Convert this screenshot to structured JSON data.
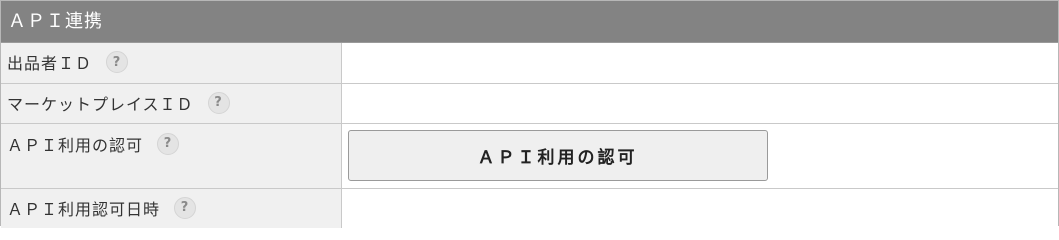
{
  "panel": {
    "title": "ＡＰＩ連携"
  },
  "rows": [
    {
      "label": "出品者ＩＤ",
      "help_icon": "question-circle-icon",
      "value": ""
    },
    {
      "label": "マーケットプレイスＩＤ",
      "help_icon": "question-circle-icon",
      "value": ""
    },
    {
      "label": "ＡＰＩ利用の認可",
      "help_icon": "question-circle-icon",
      "button_label": "ＡＰＩ利用の認可"
    },
    {
      "label": "ＡＰＩ利用認可日時",
      "help_icon": "question-circle-icon",
      "value": ""
    }
  ],
  "help_glyph": "?",
  "colors": {
    "header_bg": "#838383",
    "label_bg": "#f0f0f0",
    "button_bg": "#efefef"
  }
}
